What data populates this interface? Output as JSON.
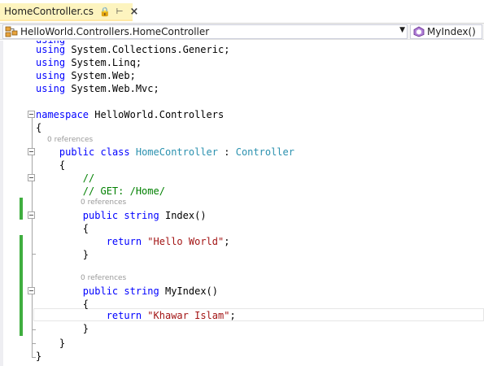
{
  "tab": {
    "title": "HomeController.cs"
  },
  "navbar": {
    "class_selector": "HelloWorld.Controllers.HomeController",
    "member_selector": "MyIndex()"
  },
  "icons": {
    "pin": "pin-icon",
    "close": "close-icon",
    "dropdown": "chevron-down-icon",
    "class": "class-icon",
    "method": "method-icon"
  },
  "code": {
    "using_kw": "using",
    "using_1": "System.Collections.Generic;",
    "using_2": "System.Linq;",
    "using_3": "System.Web;",
    "using_4": "System.Web.Mvc;",
    "ns_kw": "namespace",
    "ns_name": "HelloWorld.Controllers",
    "open_brace": "{",
    "close_brace": "}",
    "public_kw": "public",
    "class_kw": "class",
    "class_name": "HomeController",
    "colon": ":",
    "base_class": "Controller",
    "comment_1": "//",
    "comment_2": "// GET: /Home/",
    "string_kw": "string",
    "method_1": "Index()",
    "method_2": "MyIndex()",
    "return_kw": "return",
    "return_1": "\"Hello World\"",
    "return_2": "\"Khawar Islam\"",
    "semicolon": ";",
    "references": "0 references"
  },
  "colors": {
    "keyword": "#0000ff",
    "type": "#2b91af",
    "string": "#a31515",
    "comment": "#008000",
    "change_marker": "#3fae3f",
    "active_tab": "#fdf4bf"
  }
}
